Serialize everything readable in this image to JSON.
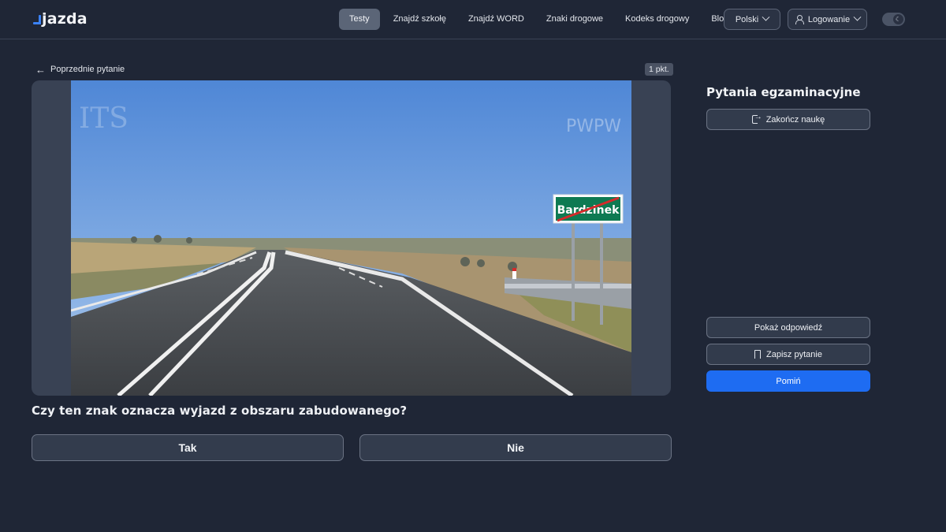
{
  "brand": {
    "name": "jazda"
  },
  "nav": {
    "items": [
      "Testy",
      "Znajdź szkołę",
      "Znajdź WORD",
      "Znaki drogowe",
      "Kodeks drogowy",
      "Blog"
    ],
    "active": "Testy"
  },
  "header": {
    "language_label": "Polski",
    "login_label": "Logowanie",
    "theme_icon": "moon-icon"
  },
  "question": {
    "back_label": "Poprzednie pytanie",
    "points_label": "1 pkt.",
    "text": "Czy ten znak oznacza wyjazd z obszaru zabudowanego?",
    "answers": [
      "Tak",
      "Nie"
    ],
    "image": {
      "sign_text": "Bardzinek",
      "watermark_left": "ITS",
      "watermark_right": "PWPW"
    }
  },
  "panel": {
    "title": "Pytania egzaminacyjne",
    "end_label": "Zakończ naukę",
    "show_answer_label": "Pokaż odpowiedź",
    "save_label": "Zapisz pytanie",
    "skip_label": "Pomiń"
  },
  "colors": {
    "background": "#1f2636",
    "accent": "#1e6cf2",
    "sign_green": "#0e7a52"
  }
}
